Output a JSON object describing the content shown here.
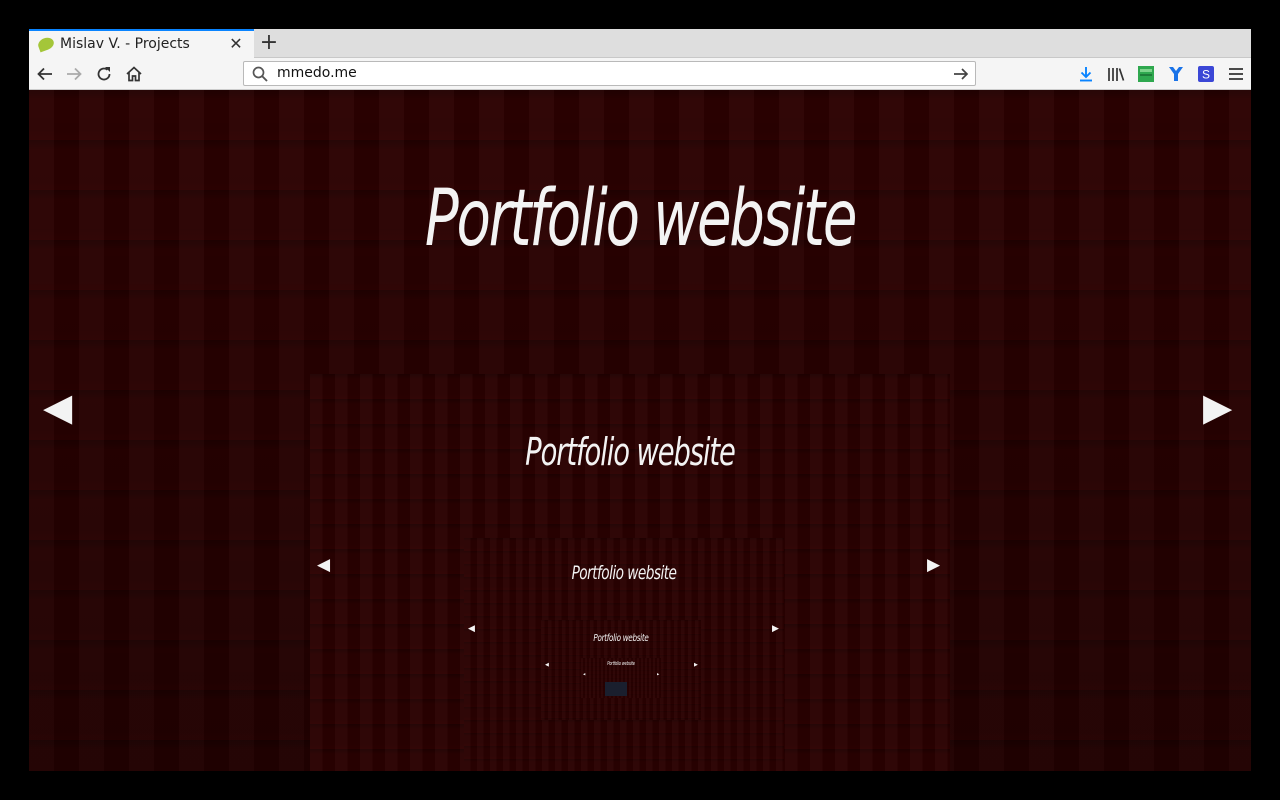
{
  "tab": {
    "title": "Mislav V. - Projects",
    "close_label": "✕",
    "new_tab_label": "+"
  },
  "navbar": {
    "url": "mmedo.me",
    "accent": "#0a84ff"
  },
  "icons": {
    "back": "back-arrow-icon",
    "forward": "forward-arrow-icon",
    "reload": "reload-icon",
    "home": "home-icon",
    "download": "download-icon",
    "library": "library-icon",
    "extension_green": "green-extension-icon",
    "extension_blue": "blue-extension-icon",
    "extension_s": "s-extension-icon",
    "menu": "hamburger-menu-icon"
  },
  "page": {
    "title": "Portfolio website",
    "prev_arrow": "◀",
    "next_arrow": "▶",
    "background_color": "#2c0101"
  }
}
